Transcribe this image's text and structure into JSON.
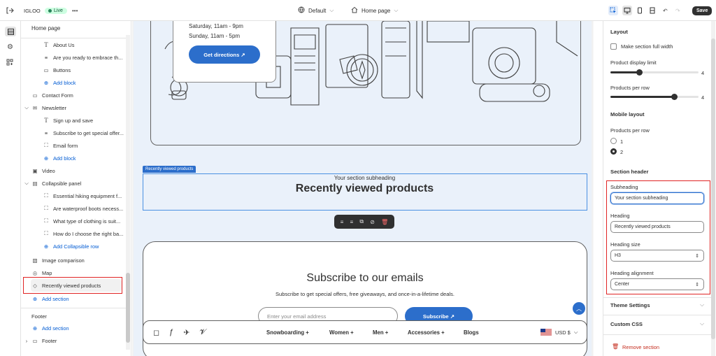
{
  "topbar": {
    "store_name": "IGLOO",
    "live_label": "Live",
    "more": "•••",
    "theme_select": "Default",
    "page_select": "Home page",
    "save_label": "Save"
  },
  "left_panel": {
    "header": "Home page",
    "items": [
      {
        "label": "About Us",
        "icon": "heading-icon"
      },
      {
        "label": "Are you ready to embrace th...",
        "icon": "text-icon"
      },
      {
        "label": "Buttons",
        "icon": "buttons-icon"
      },
      {
        "label": "Add block",
        "icon": "plus-circle-icon"
      },
      {
        "label": "Contact Form",
        "icon": "form-icon"
      },
      {
        "label": "Newsletter",
        "icon": "envelope-icon"
      },
      {
        "label": "Sign up and save",
        "icon": "heading-icon"
      },
      {
        "label": "Subscribe to get special offer...",
        "icon": "text-icon"
      },
      {
        "label": "Email form",
        "icon": "field-icon"
      },
      {
        "label": "Add block",
        "icon": "plus-circle-icon"
      },
      {
        "label": "Video",
        "icon": "video-icon"
      },
      {
        "label": "Collapsible panel",
        "icon": "collapsible-icon"
      },
      {
        "label": "Essential hiking equipment f...",
        "icon": "field-icon"
      },
      {
        "label": "Are waterproof boots necess...",
        "icon": "field-icon"
      },
      {
        "label": "What type of clothing is suit...",
        "icon": "field-icon"
      },
      {
        "label": "How do I choose the right ba...",
        "icon": "field-icon"
      },
      {
        "label": "Add Collapsible row",
        "icon": "plus-circle-icon"
      },
      {
        "label": "Image comparison",
        "icon": "image-icon"
      },
      {
        "label": "Map",
        "icon": "pin-icon"
      },
      {
        "label": "Recently viewed products",
        "icon": "tag-icon"
      },
      {
        "label": "Add section",
        "icon": "plus-circle-icon"
      }
    ],
    "footer_group": "Footer",
    "footer_add": "Add section",
    "footer_item": "Footer"
  },
  "preview": {
    "hours_sat": "Saturday, 11am - 9pm",
    "hours_sun": "Sunday, 11am - 5pm",
    "directions_button": "Get directions ↗",
    "section_tag": "Recently viewed products",
    "subheading": "Your section subheading",
    "heading": "Recently viewed products",
    "subscribe_title": "Subscribe to our emails",
    "subscribe_text": "Subscribe to get special offers, free giveaways, and once-in-a-lifetime deals.",
    "email_placeholder": "Enter your email address",
    "subscribe_button": "Subscribe ↗",
    "nav": [
      "Snowboarding +",
      "Women +",
      "Men +",
      "Accessories +",
      "Blogs"
    ],
    "currency": "USD $"
  },
  "right_panel": {
    "layout_heading": "Layout",
    "full_width_label": "Make section full width",
    "display_limit_label": "Product display limit",
    "display_limit_value": "4",
    "per_row_label": "Products per row",
    "per_row_value": "4",
    "mobile_heading": "Mobile layout",
    "mobile_per_row_label": "Products per row",
    "mobile_options": [
      "1",
      "2"
    ],
    "mobile_selected": "2",
    "section_header": "Section header",
    "subheading_label": "Subheading",
    "subheading_value": "Your section subheading",
    "heading_label": "Heading",
    "heading_value": "Recently viewed products",
    "heading_size_label": "Heading size",
    "heading_size_value": "H3",
    "alignment_label": "Heading alignment",
    "alignment_value": "Center",
    "theme_settings": "Theme Settings",
    "custom_css": "Custom CSS",
    "remove_section": "Remove section"
  },
  "colors": {
    "accent_blue": "#2c6ecb",
    "highlight_red": "#e02424",
    "live_green": "#29845a"
  }
}
